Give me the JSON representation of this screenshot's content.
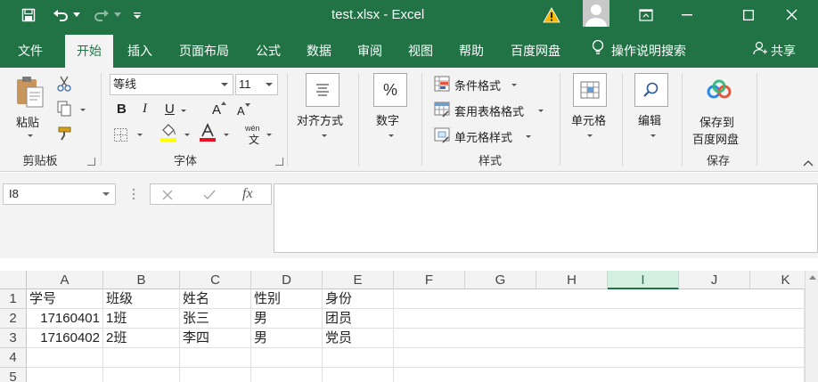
{
  "window": {
    "title": "test.xlsx  -  Excel"
  },
  "quick_access": {
    "save_icon": "save-icon",
    "undo_icon": "undo-icon",
    "redo_icon": "redo-icon",
    "customize_icon": "customize-qat-icon"
  },
  "tabs": [
    {
      "label": "文件"
    },
    {
      "label": "开始"
    },
    {
      "label": "插入"
    },
    {
      "label": "页面布局"
    },
    {
      "label": "公式"
    },
    {
      "label": "数据"
    },
    {
      "label": "审阅"
    },
    {
      "label": "视图"
    },
    {
      "label": "帮助"
    },
    {
      "label": "百度网盘"
    }
  ],
  "tell_me": "操作说明搜索",
  "share": "共享",
  "ribbon": {
    "clipboard": {
      "paste": "粘贴",
      "label": "剪贴板"
    },
    "font": {
      "name": "等线",
      "size": "11",
      "bold": "B",
      "italic": "I",
      "underline": "U",
      "grow": "A",
      "shrink": "A",
      "phonetic_top": "wén",
      "phonetic_bottom": "文",
      "label": "字体"
    },
    "alignment": {
      "label": "对齐方式"
    },
    "number": {
      "symbol": "%",
      "label": "数字"
    },
    "styles": {
      "conditional": "条件格式",
      "table": "套用表格格式",
      "cell": "单元格样式",
      "label": "样式"
    },
    "cells": {
      "label": "单元格"
    },
    "editing": {
      "label": "编辑"
    },
    "save": {
      "button_line1": "保存到",
      "button_line2": "百度网盘",
      "label": "保存"
    }
  },
  "formula_bar": {
    "name_box": "I8",
    "fx": "fx",
    "value": ""
  },
  "sheet": {
    "columns": [
      "A",
      "B",
      "C",
      "D",
      "E",
      "F",
      "G",
      "H",
      "I",
      "J",
      "K"
    ],
    "selected_column": "I",
    "rows": [
      {
        "n": "1",
        "cells": [
          "学号",
          "班级",
          "姓名",
          "性别",
          "身份"
        ]
      },
      {
        "n": "2",
        "cells": [
          "17160401",
          "1班",
          "张三",
          "男",
          "团员"
        ]
      },
      {
        "n": "3",
        "cells": [
          "17160402",
          "2班",
          "李四",
          "男",
          "党员"
        ]
      },
      {
        "n": "4",
        "cells": [
          "",
          "",
          "",
          "",
          ""
        ]
      },
      {
        "n": "5",
        "cells": [
          "",
          "",
          "",
          "",
          ""
        ]
      }
    ]
  },
  "colors": {
    "brand": "#217346",
    "ribbon_bg": "#f3f3f3",
    "font_highlight": "#ffff00",
    "font_color": "#e81123"
  }
}
